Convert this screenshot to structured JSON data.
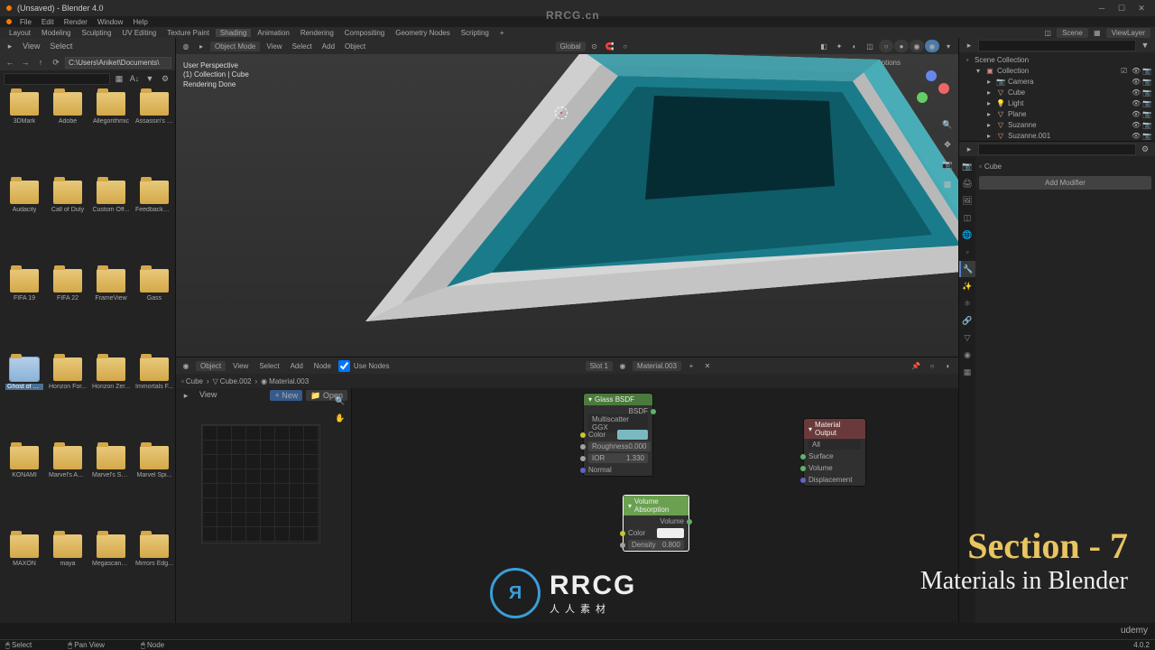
{
  "window": {
    "title": "(Unsaved) - Blender 4.0"
  },
  "menubar": [
    "File",
    "Edit",
    "Render",
    "Window",
    "Help"
  ],
  "workspaces": [
    "Layout",
    "Modeling",
    "Sculpting",
    "UV Editing",
    "Texture Paint",
    "Shading",
    "Animation",
    "Rendering",
    "Compositing",
    "Geometry Nodes",
    "Scripting"
  ],
  "active_workspace": "Shading",
  "scene_label": "Scene",
  "viewlayer_label": "ViewLayer",
  "filebrowser": {
    "menus": [
      "View",
      "Select"
    ],
    "path": "C:\\Users\\Aniket\\Documents\\",
    "search_ph": "",
    "folders": [
      "3DMark",
      "Adobe",
      "Allegorithmic",
      "Assassin's C...",
      "Audacity",
      "Call of Duty",
      "Custom Off...",
      "FeedbackHub",
      "FIFA 19",
      "FIFA 22",
      "FrameView",
      "Gass",
      "Ghost of Ts...",
      "Horizon For...",
      "Horizon Zer...",
      "Immortals F...",
      "KONAMI",
      "Marvel's Ave...",
      "Marvel's Spi...",
      "Marvel Spi...",
      "MAXON",
      "maya",
      "Megascans ...",
      "Mirrors Edg..."
    ],
    "selected_folder": 12
  },
  "viewport": {
    "header": {
      "mode": "Object Mode",
      "menus": [
        "View",
        "Select",
        "Add",
        "Object"
      ],
      "orientation": "Global"
    },
    "info": {
      "l1": "User Perspective",
      "l2": "(1) Collection | Cube",
      "l3": "Rendering Done"
    },
    "options": "Options"
  },
  "node_editor": {
    "header": {
      "mode": "Object",
      "menus": [
        "View",
        "Select",
        "Add",
        "Node"
      ],
      "use_nodes": "Use Nodes",
      "slot": "Slot 1",
      "material": "Material.003"
    },
    "breadcrumb": [
      "Cube",
      "Cube.002",
      "Material.003"
    ],
    "nodes": {
      "glass": {
        "title": "Glass BSDF",
        "out": "BSDF",
        "dist": "Multiscatter GGX",
        "color_label": "Color",
        "rough_label": "Roughness",
        "rough_val": "0.000",
        "ior_label": "IOR",
        "ior_val": "1.330",
        "normal": "Normal"
      },
      "volabs": {
        "title": "Volume Absorption",
        "out": "Volume",
        "color_label": "Color",
        "density_label": "Density",
        "density_val": "0.800"
      },
      "output": {
        "title": "Material Output",
        "target": "All",
        "surface": "Surface",
        "volume": "Volume",
        "disp": "Displacement"
      }
    },
    "sidebar_menus": [
      "View"
    ],
    "new": "New",
    "open": "Open"
  },
  "outliner": {
    "scene": "Scene Collection",
    "collection": "Collection",
    "items": [
      "Camera",
      "Cube",
      "Light",
      "Plane",
      "Suzanne",
      "Suzanne.001"
    ]
  },
  "properties": {
    "object_name": "Cube",
    "add_modifier": "Add Modifier"
  },
  "statusbar": {
    "select": "Select",
    "pan": "Pan View",
    "node": "Node",
    "version": "4.0.2"
  },
  "overlay": {
    "section": "Section - 7",
    "subtitle": "Materials in Blender",
    "rrcg": "RRCG",
    "rrcg_sub": "人人素材",
    "rrcg_cn": "RRCG.cn",
    "udemy": "udemy"
  }
}
